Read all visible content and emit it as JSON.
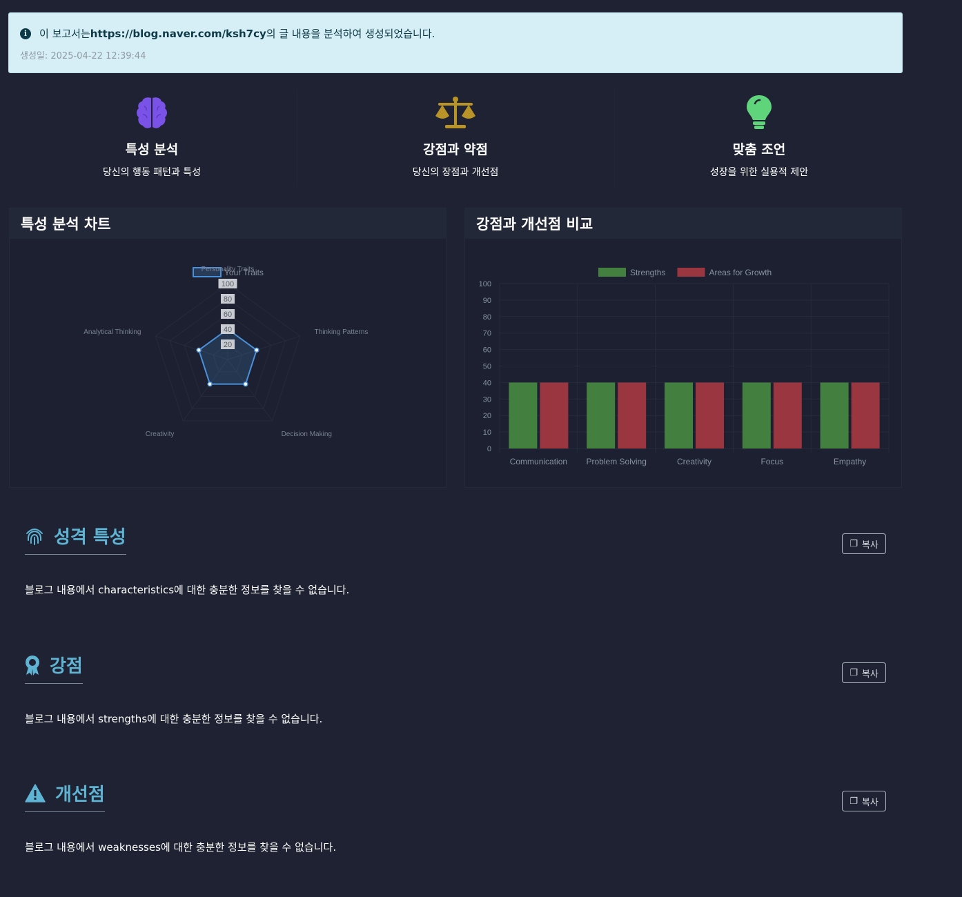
{
  "alert": {
    "prefix": "이 보고서는 ",
    "url": "https://blog.naver.com/ksh7cy",
    "suffix": "의 글 내용을 분석하여 생성되었습니다.",
    "date": "생성일: 2025-04-22 12:39:44",
    "icon": "info-icon"
  },
  "features": [
    {
      "icon": "brain-icon",
      "color": "#7b52e8",
      "title": "특성 분석",
      "desc": "당신의 행동 패턴과 특성"
    },
    {
      "icon": "scale-icon",
      "color": "#b89428",
      "title": "강점과 약점",
      "desc": "당신의 장점과 개선점"
    },
    {
      "icon": "lightbulb-icon",
      "color": "#5fd47a",
      "title": "맞춤 조언",
      "desc": "성장을 위한 실용적 제안"
    }
  ],
  "cards": {
    "radar_title": "특성 분석 차트",
    "bar_title": "강점과 개선점 비교"
  },
  "chart_data": [
    {
      "type": "radar",
      "title": "Personality Traits",
      "categories": [
        "Personality Traits",
        "Thinking Patterns",
        "Decision Making",
        "Creativity",
        "Analytical Thinking"
      ],
      "series": [
        {
          "name": "Your Traits",
          "values": [
            40,
            40,
            40,
            40,
            40
          ],
          "color": "#4a90d9"
        }
      ],
      "ticks": [
        "20",
        "40",
        "60",
        "80",
        "100"
      ],
      "ylim": [
        0,
        100
      ],
      "legend": "top"
    },
    {
      "type": "bar",
      "categories": [
        "Communication",
        "Problem Solving",
        "Creativity",
        "Focus",
        "Empathy"
      ],
      "series": [
        {
          "name": "Strengths",
          "values": [
            40,
            40,
            40,
            40,
            40
          ],
          "color": "#43803f"
        },
        {
          "name": "Areas for Growth",
          "values": [
            40,
            40,
            40,
            40,
            40
          ],
          "color": "#9a3640"
        }
      ],
      "yticks": [
        "0",
        "10",
        "20",
        "30",
        "40",
        "50",
        "60",
        "70",
        "80",
        "90",
        "100"
      ],
      "ylim": [
        0,
        100
      ],
      "legend": "top",
      "grid": true
    }
  ],
  "sections": [
    {
      "icon": "fingerprint-icon",
      "title": "성격 특성",
      "copy": "복사",
      "body": "블로그 내용에서 characteristics에 대한 충분한 정보를 찾을 수 없습니다."
    },
    {
      "icon": "award-icon",
      "title": "강점",
      "copy": "복사",
      "body": "블로그 내용에서 strengths에 대한 충분한 정보를 찾을 수 없습니다."
    },
    {
      "icon": "warning-icon",
      "title": "개선점",
      "copy": "복사",
      "body": "블로그 내용에서 weaknesses에 대한 충분한 정보를 찾을 수 없습니다."
    }
  ]
}
